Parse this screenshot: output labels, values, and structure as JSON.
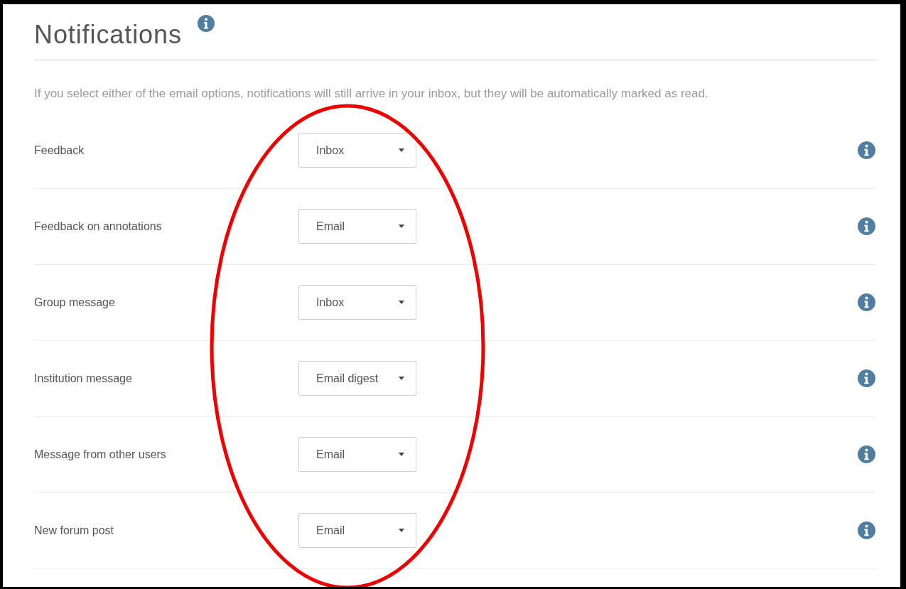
{
  "title": "Notifications",
  "intro": "If you select either of the email options, notifications will still arrive in your inbox, but they will be automatically marked as read.",
  "settings": [
    {
      "label": "Feedback",
      "value": "Inbox"
    },
    {
      "label": "Feedback on annotations",
      "value": "Email"
    },
    {
      "label": "Group message",
      "value": "Inbox"
    },
    {
      "label": "Institution message",
      "value": "Email digest"
    },
    {
      "label": "Message from other users",
      "value": "Email"
    },
    {
      "label": "New forum post",
      "value": "Email"
    }
  ]
}
